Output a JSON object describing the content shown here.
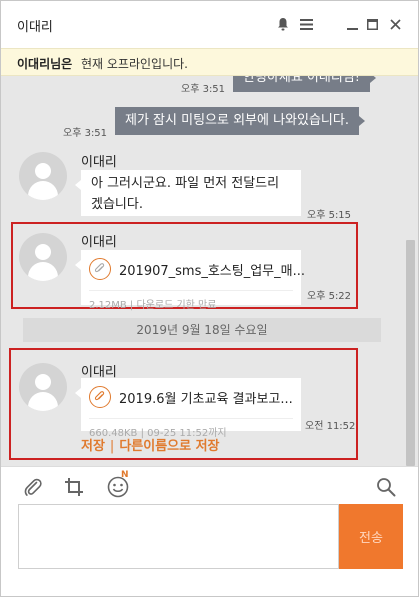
{
  "window": {
    "title": "이대리",
    "icons": [
      "bell-icon",
      "menu-icon",
      "minimize-icon",
      "maximize-icon",
      "close-icon"
    ]
  },
  "notice": {
    "name": "이대리님은",
    "text": "현재 오프라인입니다."
  },
  "messages": {
    "partial_top": {
      "time": "오후 3:51",
      "text": "안녕하세요 이대리님!"
    },
    "mine": {
      "time": "오후 3:51",
      "text": "제가 잠시 미팅으로 외부에 나와있습니다."
    },
    "reply": {
      "sender": "이대리",
      "line1": "아 그러시군요. 파일 먼저 전달드리",
      "line2": "겠습니다.",
      "time": "오후 5:15"
    },
    "file1": {
      "sender": "이대리",
      "file_name": "201907_sms_호스팅_업무_매...",
      "meta": "2.12MB | 다운로드 기한 만료",
      "time": "오후 5:22"
    },
    "date_separator": "2019년 9월 18일 수요일",
    "file2": {
      "sender": "이대리",
      "file_name": "2019.6월 기초교육 결과보고...",
      "meta": "660.48KB | 09-25 11:52까지",
      "time": "오전 11:52",
      "save_label": "저장",
      "divider": "|",
      "save_as_label": "다른이름으로 저장"
    }
  },
  "toolbar": {
    "icons": [
      "attach-icon",
      "crop-icon",
      "emoji-icon",
      "search-icon"
    ],
    "emoji_badge": "N"
  },
  "composer": {
    "value": "",
    "send_label": "전송"
  },
  "colors": {
    "accent": "#f0782d",
    "highlight": "#cc2222",
    "my_bubble": "#777d88",
    "chat_bg": "#e7e7e7",
    "notice_bg": "#fdf8dc"
  }
}
